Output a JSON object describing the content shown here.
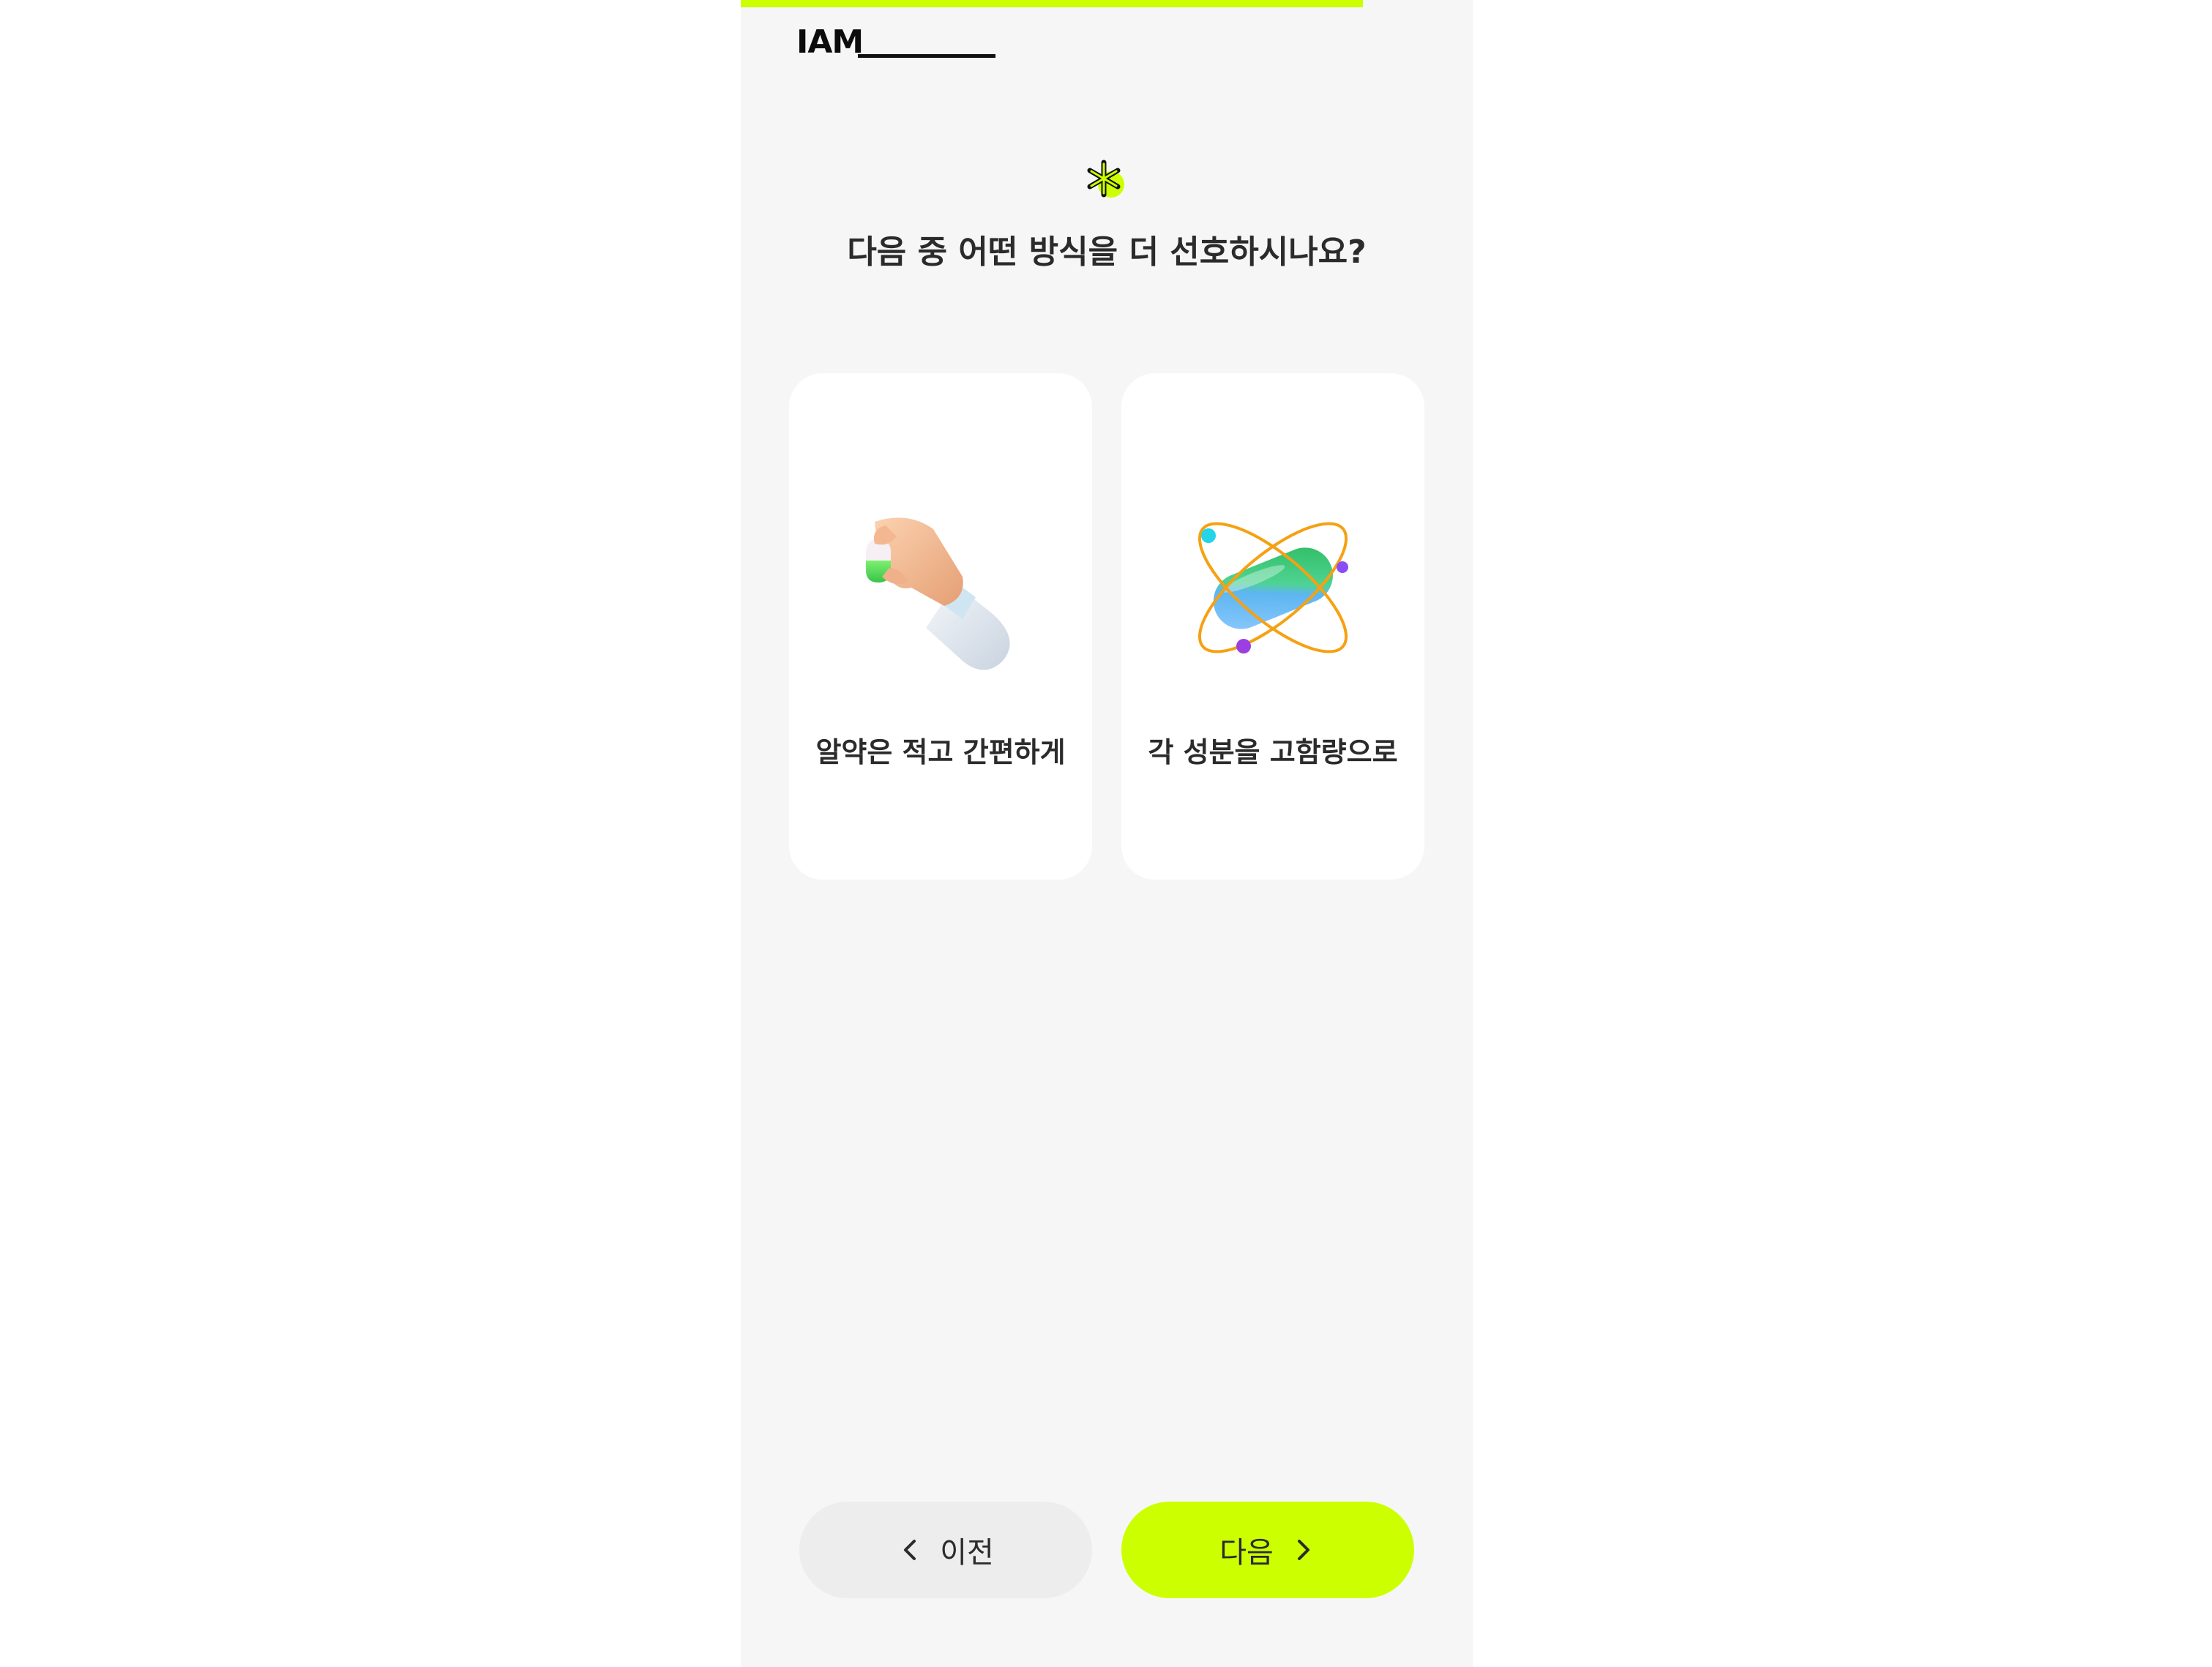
{
  "progress": {
    "value": 0.85
  },
  "header": {
    "logo_text": "IAM"
  },
  "question": {
    "icon": "asterisk-spark-icon",
    "text": "다음 중 어떤 방식을 더 선호하시나요?"
  },
  "options": [
    {
      "label": "알약은 적고 간편하게",
      "icon": "hand-holding-capsule-icon"
    },
    {
      "label": "각 성분을 고함량으로",
      "icon": "capsule-orbit-icon"
    }
  ],
  "nav": {
    "prev_label": "이전",
    "next_label": "다음"
  },
  "colors": {
    "accent": "#ccff00",
    "background": "#f6f6f6",
    "card": "#ffffff",
    "text": "#2b2b2b",
    "prev_button": "#ededed"
  }
}
